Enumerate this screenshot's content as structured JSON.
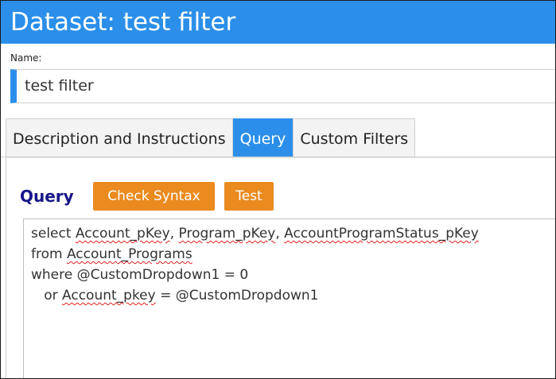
{
  "window": {
    "title": "Dataset: test filter"
  },
  "name_field": {
    "label": "Name:",
    "value": "test filter"
  },
  "tabs": [
    {
      "label": "Description and Instructions",
      "active": false
    },
    {
      "label": "Query",
      "active": true
    },
    {
      "label": "Custom Filters",
      "active": false
    }
  ],
  "query_panel": {
    "heading": "Query",
    "check_syntax_label": "Check Syntax",
    "test_label": "Test",
    "code": {
      "line1": {
        "p1": "select ",
        "w1": "Account_pKey",
        "p2": ", ",
        "w2": "Program_pKey",
        "p3": ", ",
        "w3": "AccountProgramStatus_pKey"
      },
      "line2": {
        "p1": "from ",
        "w1": "Account_Programs"
      },
      "line3": {
        "p1": "where @CustomDropdown1 = 0"
      },
      "line4": {
        "p1": "   or ",
        "w1": "Account_pkey",
        "p2": " = @CustomDropdown1"
      }
    }
  },
  "colors": {
    "accent_blue": "#2b8fea",
    "button_orange": "#ea8a1f",
    "heading_navy": "#16168a",
    "spellcheck_red": "#e02020"
  }
}
